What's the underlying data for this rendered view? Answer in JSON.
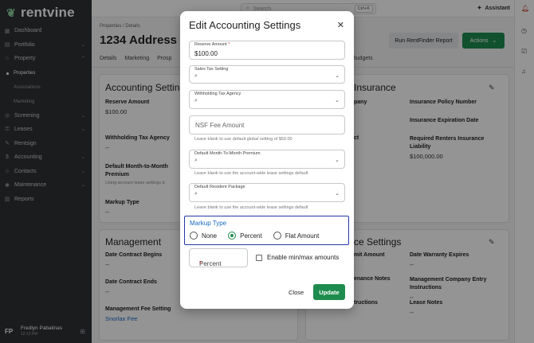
{
  "brand": {
    "name": "rentvine",
    "logo_icon": "rentvine-leaf-icon"
  },
  "sidebar": {
    "items": [
      {
        "label": "Dashboard",
        "icon": "dashboard-icon"
      },
      {
        "label": "Portfolio",
        "icon": "briefcase-icon",
        "chevron": true
      },
      {
        "label": "Property",
        "icon": "building-icon",
        "chevron": true
      },
      {
        "label": "Screening",
        "icon": "screening-icon",
        "chevron": true
      },
      {
        "label": "Leases",
        "icon": "lease-icon",
        "chevron": true
      },
      {
        "label": "Rentsign",
        "icon": "sign-icon"
      },
      {
        "label": "Accounting",
        "icon": "dollar-icon",
        "chevron": true
      },
      {
        "label": "Contacts",
        "icon": "contacts-icon",
        "chevron": true
      },
      {
        "label": "Maintenance",
        "icon": "wrench-icon",
        "chevron": true
      },
      {
        "label": "Reports",
        "icon": "chart-icon"
      }
    ],
    "sub_items": [
      "Properties",
      "Associations",
      "Marketing"
    ],
    "user": {
      "initials": "FP",
      "name": "Fredlyn Pabalinas",
      "time": "12:13 PM"
    }
  },
  "topbar": {
    "search_placeholder": "Search",
    "shortcut": "Ctrl+K",
    "assistant_label": "Assistant"
  },
  "page": {
    "breadcrumb": [
      "Properties",
      "Details"
    ],
    "title": "1234 Address La",
    "run_button": "Run RentFinder Report",
    "actions_button": "Actions",
    "tabs": [
      "Details",
      "Marketing",
      "Prosp"
    ],
    "tab_budgets": "Budgets"
  },
  "accounting_card": {
    "title": "Accounting Setting",
    "reserve_label": "Reserve Amount",
    "reserve_value": "$100.00",
    "withholding_label": "Withholding Tax Agency",
    "withholding_value": "--",
    "m2m_label": "Default Month-to-Month Premium",
    "m2m_hint": "Using account lease settings d",
    "markup_label": "Markup Type",
    "markup_value": "--"
  },
  "insurance_card": {
    "title": "Insurance",
    "company_label": "pany",
    "policy_label": "Insurance Policy Number",
    "expiration_label": "Insurance Expiration Date",
    "ct_label": "ct",
    "required_label": "Required Renters Insurance Liability",
    "required_value": "$100,000.00"
  },
  "management_card": {
    "title": "Management",
    "contract_begins_label": "Date Contract Begins",
    "contract_begins_value": "--",
    "contract_ends_label": "Date Contract Ends",
    "contract_ends_value": "--",
    "fee_label": "Management Fee Setting",
    "fee_value": "Snorlax Fee"
  },
  "service_card": {
    "title": "ce Settings",
    "limit_label": "mit Amount",
    "warranty_label": "Date Warranty Expires",
    "warranty_value": "--",
    "notes_label": "enance Notes",
    "entry_label": "Management Company Entry Instructions",
    "entry_value": "--",
    "instr_label": "tructions",
    "lease_notes_label": "Lease Notes",
    "lease_notes_value": "--"
  },
  "modal": {
    "title": "Edit Accounting Settings",
    "reserve": {
      "label": "Reserve Amount",
      "value": "$100.00"
    },
    "sales_tax": {
      "label": "Sales Tax Setting"
    },
    "withholding": {
      "label": "Withholding Tax Agency"
    },
    "nsf": {
      "placeholder": "NSF Fee Amount",
      "hint": "Leave blank to use default global setting of $50.00"
    },
    "m2m": {
      "label": "Default Month-To-Month Premium",
      "hint": "Leave blank to use the account-wide lease settings default"
    },
    "resident_package": {
      "label": "Default Resident Package",
      "hint": "Leave blank to use the account-wide lease settings default"
    },
    "markup": {
      "title": "Markup Type",
      "options": [
        "None",
        "Percent",
        "Flat Amount"
      ],
      "selected": "Percent"
    },
    "percent": {
      "placeholder": "Percent"
    },
    "minmax_label": "Enable min/max amounts",
    "close_button": "Close",
    "update_button": "Update"
  }
}
